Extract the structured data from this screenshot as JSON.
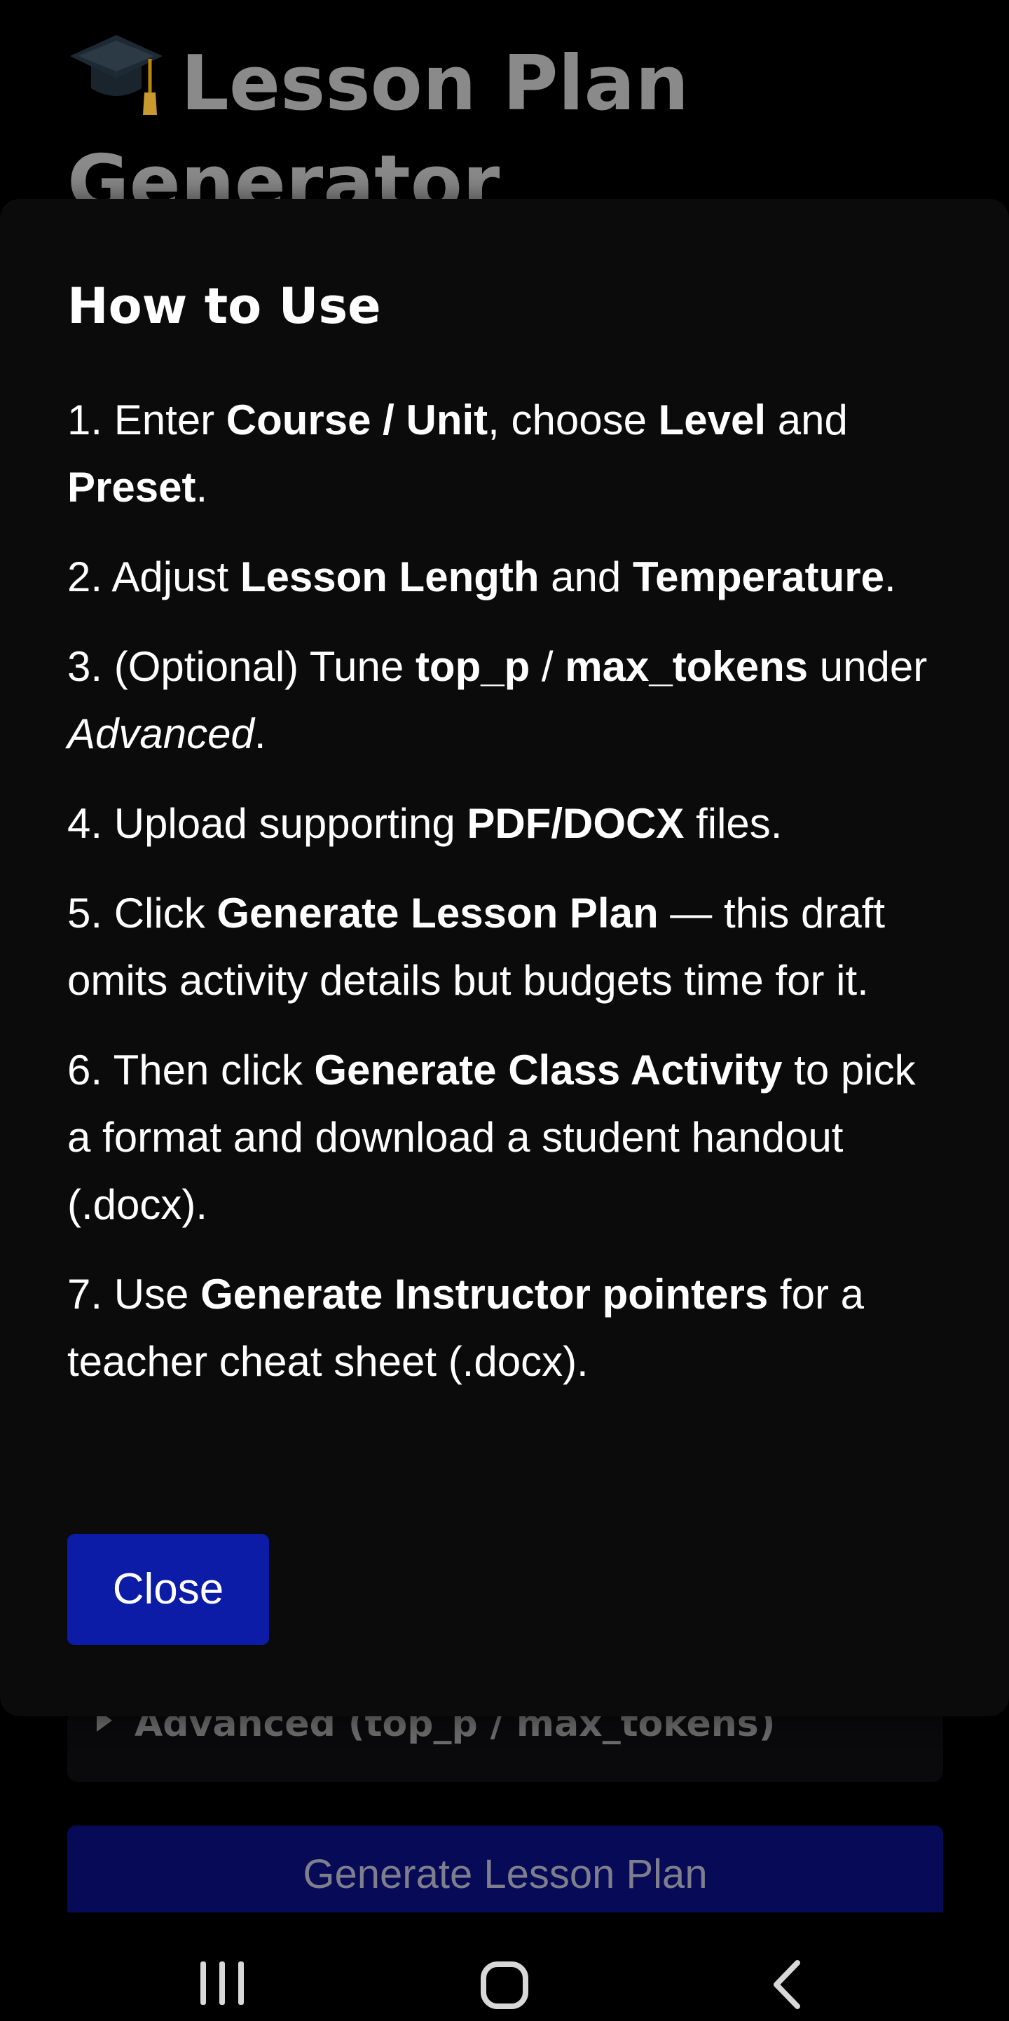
{
  "app": {
    "title": "Lesson Plan Generator",
    "title_icon": "graduation-cap-icon"
  },
  "background": {
    "advanced_label": "Advanced (top_p / max_tokens)",
    "generate_button_label": "Generate Lesson Plan"
  },
  "modal": {
    "title": "How to Use",
    "steps": [
      [
        {
          "t": "1. Enter "
        },
        {
          "t": "Course / Unit",
          "s": "b"
        },
        {
          "t": ", choose "
        },
        {
          "t": "Level",
          "s": "b"
        },
        {
          "t": " and "
        },
        {
          "t": "Preset",
          "s": "b"
        },
        {
          "t": "."
        }
      ],
      [
        {
          "t": "2. Adjust "
        },
        {
          "t": "Lesson Length",
          "s": "b"
        },
        {
          "t": " and "
        },
        {
          "t": "Temperature",
          "s": "b"
        },
        {
          "t": "."
        }
      ],
      [
        {
          "t": "3. (Optional) Tune "
        },
        {
          "t": "top_p",
          "s": "b"
        },
        {
          "t": " / "
        },
        {
          "t": "max_tokens",
          "s": "b"
        },
        {
          "t": " under "
        },
        {
          "t": "Advanced",
          "s": "i"
        },
        {
          "t": "."
        }
      ],
      [
        {
          "t": "4. Upload supporting "
        },
        {
          "t": "PDF/DOCX",
          "s": "b"
        },
        {
          "t": " files."
        }
      ],
      [
        {
          "t": "5. Click "
        },
        {
          "t": "Generate Lesson Plan",
          "s": "b"
        },
        {
          "t": " — this draft omits activity details but budgets time for it."
        }
      ],
      [
        {
          "t": "6. Then click "
        },
        {
          "t": "Generate Class Activity",
          "s": "b"
        },
        {
          "t": " to pick a format and download a student handout (.docx)."
        }
      ],
      [
        {
          "t": "7. Use "
        },
        {
          "t": "Generate Instructor pointers",
          "s": "b"
        },
        {
          "t": " for a teacher cheat sheet (.docx)."
        }
      ]
    ],
    "close_label": "Close"
  },
  "navbar": {
    "recent_icon": "recent-apps-icon",
    "home_icon": "home-icon",
    "back_icon": "back-icon"
  },
  "colors": {
    "close_button": "#0c1ca6",
    "generate_button": "#060a57",
    "modal_bg": "#0b0b0b"
  }
}
